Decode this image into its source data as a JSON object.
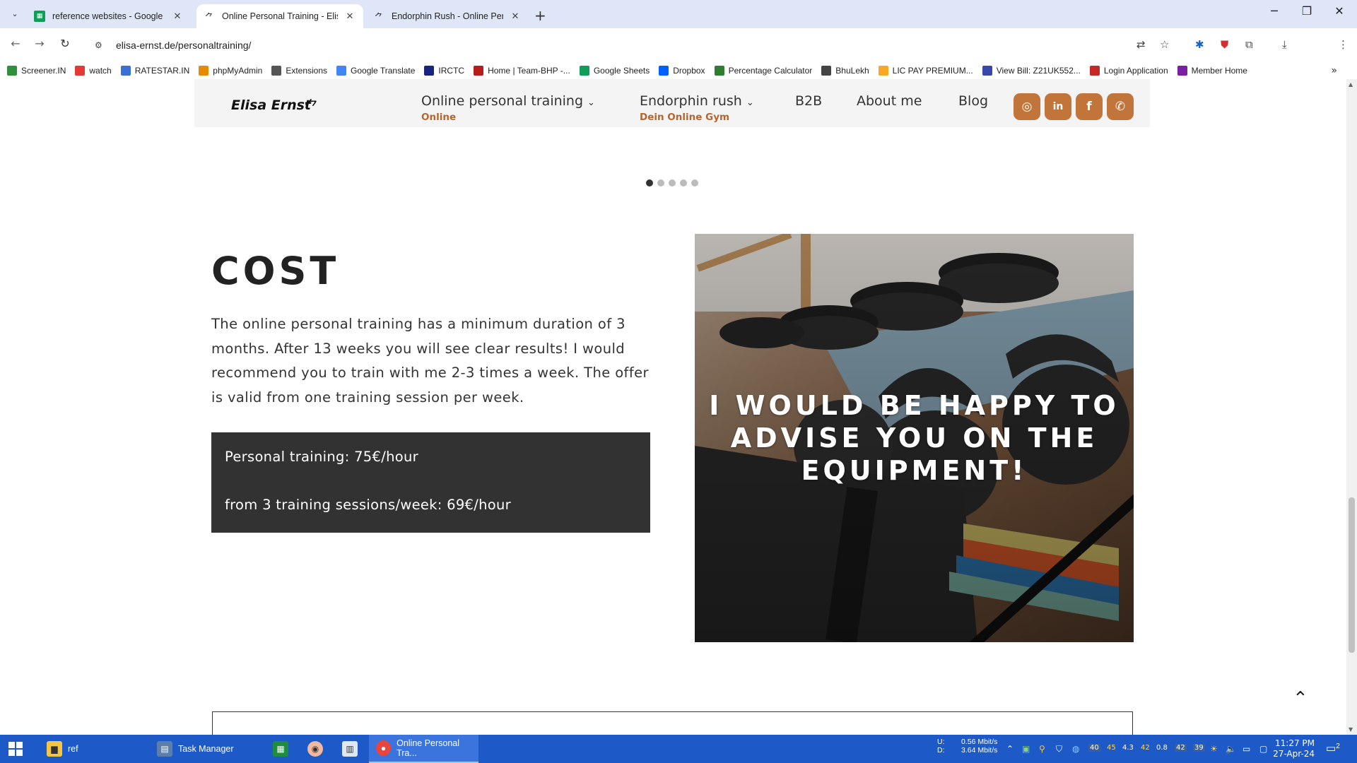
{
  "browser": {
    "tabs": [
      {
        "title": "reference websites - Google Sh",
        "active": false
      },
      {
        "title": "Online Personal Training - Elisa",
        "active": true
      },
      {
        "title": "Endorphin Rush - Online Perso",
        "active": false
      }
    ],
    "url": "elisa-ernst.de/personaltraining/",
    "bookmarks": [
      {
        "label": "Screener.IN",
        "color": "#2f8f3b"
      },
      {
        "label": "watch",
        "color": "#e53935"
      },
      {
        "label": "RATESTAR.IN",
        "color": "#3b6fd8"
      },
      {
        "label": "phpMyAdmin",
        "color": "#e68a00"
      },
      {
        "label": "Extensions",
        "color": "#555555"
      },
      {
        "label": "Google Translate",
        "color": "#4285f4"
      },
      {
        "label": "IRCTC",
        "color": "#1a237e"
      },
      {
        "label": "Home | Team-BHP -...",
        "color": "#b71c1c"
      },
      {
        "label": "Google Sheets",
        "color": "#0f9d58"
      },
      {
        "label": "Dropbox",
        "color": "#0061fe"
      },
      {
        "label": "Percentage Calculator",
        "color": "#2e7d32"
      },
      {
        "label": "BhuLekh",
        "color": "#444444"
      },
      {
        "label": "LIC PAY PREMIUM...",
        "color": "#f9a825"
      },
      {
        "label": "View Bill: Z21UK552...",
        "color": "#3949ab"
      },
      {
        "label": "Login Application",
        "color": "#c62828"
      },
      {
        "label": "Member Home",
        "color": "#7b1fa2"
      }
    ]
  },
  "site": {
    "logo": "Elisa Ernst",
    "nav": [
      {
        "label": "Online personal training",
        "sub": "Online",
        "has_caret": true
      },
      {
        "label": "Endorphin rush",
        "sub": "Dein Online Gym",
        "has_caret": true
      },
      {
        "label": "B2B",
        "sub": "",
        "has_caret": false
      },
      {
        "label": "About me",
        "sub": "",
        "has_caret": false
      },
      {
        "label": "Blog",
        "sub": "",
        "has_caret": false
      }
    ],
    "social": [
      "instagram-icon",
      "linkedin-icon",
      "facebook-icon",
      "whatsapp-icon"
    ],
    "accent": "#c2753a",
    "slider_dots": 5,
    "slider_active_index": 0
  },
  "cost": {
    "title": "COST",
    "text": "The online personal training has a minimum duration of 3 months. After 13 weeks you will see clear results! I would recommend you to train with me 2-3 times a week. The offer is valid from one training session per week.",
    "price_1": "Personal training: 75€/hour",
    "price_2": "from 3 training sessions/week: 69€/hour"
  },
  "photo": {
    "caption": "I WOULD BE HAPPY TO ADVISE YOU ON THE EQUIPMENT!"
  },
  "taskbar": {
    "apps": [
      {
        "label": "ref",
        "active": false
      },
      {
        "label": "Task Manager",
        "active": false
      },
      {
        "label": "",
        "active": false
      },
      {
        "label": "",
        "active": false
      },
      {
        "label": "",
        "active": false
      },
      {
        "label": "Online Personal Tra...",
        "active": true
      }
    ],
    "net_up": "0.56 Mbit/s",
    "net_down": "3.64 Mbit/s",
    "net_up_label": "U:",
    "net_down_label": "D:",
    "stats": [
      "45",
      "4.3",
      "42",
      "0.8"
    ],
    "time": "11:27 PM",
    "date": "27-Apr-24",
    "notification_count": "2"
  }
}
